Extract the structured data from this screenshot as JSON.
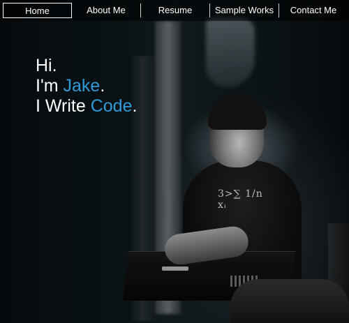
{
  "nav": {
    "items": [
      {
        "label": "Home",
        "active": true
      },
      {
        "label": "About Me",
        "active": false
      },
      {
        "label": "Resume",
        "active": false
      },
      {
        "label": "Sample Works",
        "active": false
      },
      {
        "label": "Contact Me",
        "active": false
      }
    ]
  },
  "hero": {
    "line1": "Hi.",
    "line2_prefix": "I'm ",
    "line2_name": "Jake",
    "line2_suffix": ".",
    "line3_prefix": "I Write ",
    "line3_accent": "Code",
    "line3_suffix": "."
  },
  "shirt_print_text": "3>∑ 1/n xᵢ",
  "colors": {
    "accent": "#2e9ad6",
    "nav_text": "#ffffff",
    "hero_text": "#ffffff"
  }
}
